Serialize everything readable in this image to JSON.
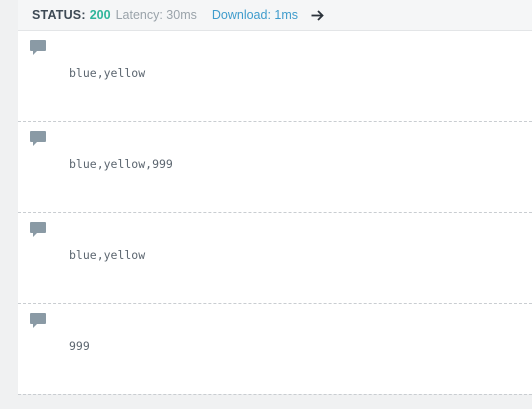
{
  "status_bar": {
    "status_label": "STATUS:",
    "status_code": "200",
    "latency": "Latency: 30ms",
    "download": "Download: 1ms",
    "arrow_icon": "arrow-right-icon"
  },
  "results": [
    {
      "value": "blue,yellow",
      "icon": "comment-icon"
    },
    {
      "value": "blue,yellow,999",
      "icon": "comment-icon"
    },
    {
      "value": "blue,yellow",
      "icon": "comment-icon"
    },
    {
      "value": "999",
      "icon": "comment-icon"
    }
  ],
  "colors": {
    "status_code": "#2fb59a",
    "download": "#3f9ccc",
    "icon": "#8a9aa5"
  }
}
